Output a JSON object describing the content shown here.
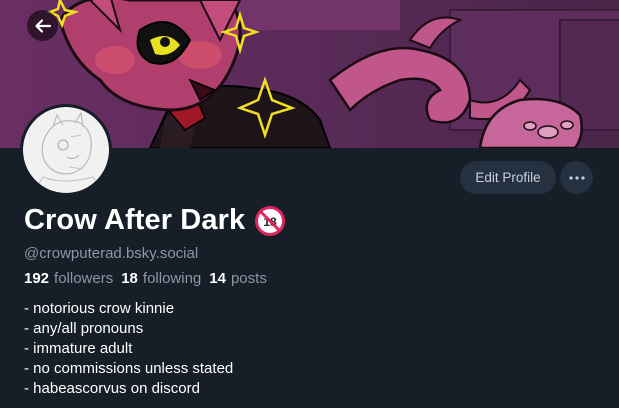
{
  "profile": {
    "display_name": "Crow After Dark",
    "handle": "@crowputerad.bsky.social",
    "content_label": "18+"
  },
  "buttons": {
    "edit_profile": "Edit Profile"
  },
  "stats": {
    "followers_count": "192",
    "followers_label": "followers",
    "following_count": "18",
    "following_label": "following",
    "posts_count": "14",
    "posts_label": "posts"
  },
  "bio": [
    "- notorious crow kinnie",
    "- any/all pronouns",
    "- immature adult",
    "- no commissions unless stated",
    "- habeascorvus on discord"
  ],
  "icons": {
    "back": "arrow-left-icon",
    "more": "ellipsis-icon",
    "badge": "adult-content-icon"
  },
  "colors": {
    "background": "#161e27",
    "button_bg": "#253040",
    "muted_text": "#8a97a6",
    "banner_purple": "#7a3a6e",
    "badge_red": "#e0245e"
  }
}
